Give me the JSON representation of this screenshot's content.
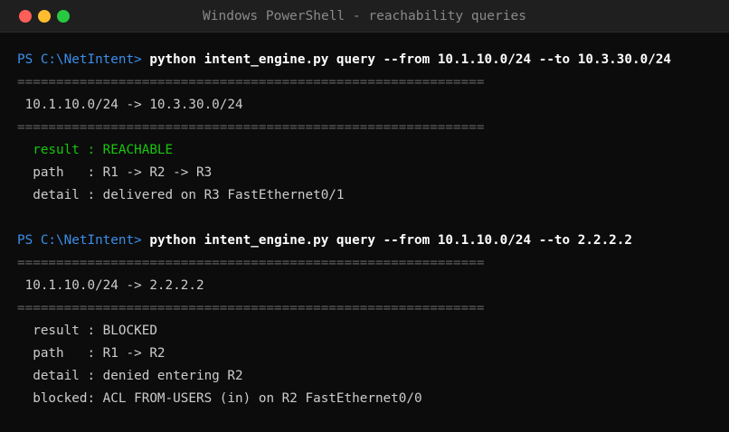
{
  "window": {
    "title": "Windows PowerShell - reachability queries"
  },
  "colors": {
    "prompt": "#3b8eea",
    "reachable": "#16c60c",
    "text": "#cccccc",
    "background": "#0c0c0c"
  },
  "queries": [
    {
      "prompt": "PS C:\\NetIntent>",
      "command": "python intent_engine.py query --from 10.1.10.0/24 --to 10.3.30.0/24",
      "rule_top": "============================================================",
      "heading": " 10.1.10.0/24 -> 10.3.30.0/24",
      "rule_bottom": "============================================================",
      "result": "  result : REACHABLE",
      "path": "  path   : R1 -> R2 -> R3",
      "detail": "  detail : delivered on R3 FastEthernet0/1"
    },
    {
      "prompt": "PS C:\\NetIntent>",
      "command": "python intent_engine.py query --from 10.1.10.0/24 --to 2.2.2.2",
      "rule_top": "============================================================",
      "heading": " 10.1.10.0/24 -> 2.2.2.2",
      "rule_bottom": "============================================================",
      "result": "  result : BLOCKED",
      "path": "  path   : R1 -> R2",
      "detail": "  detail : denied entering R2",
      "blocked": "  blocked: ACL FROM-USERS (in) on R2 FastEthernet0/0"
    }
  ]
}
